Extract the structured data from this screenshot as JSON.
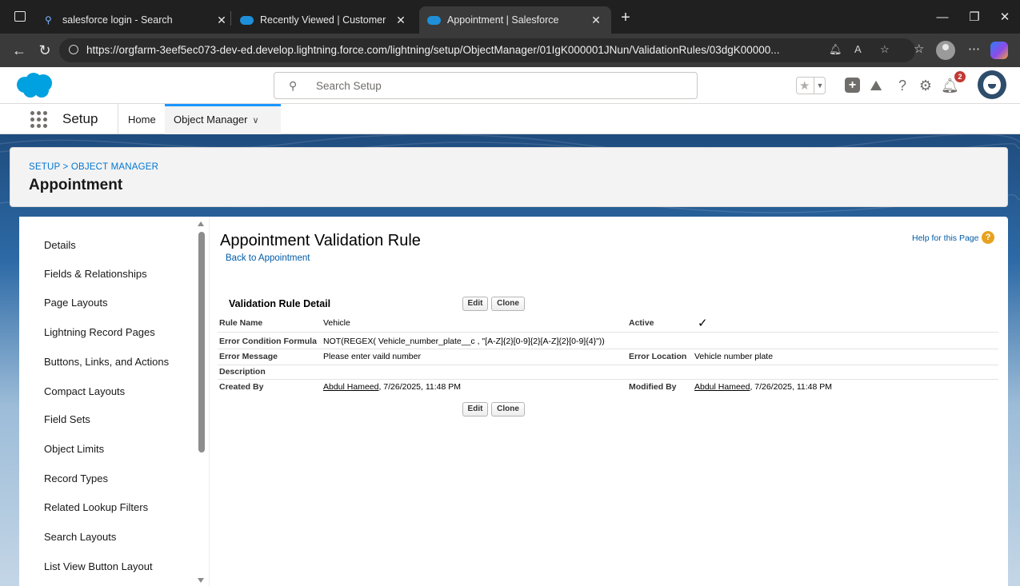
{
  "browser": {
    "tabs": [
      {
        "title": "salesforce login - Search",
        "active": false
      },
      {
        "title": "Recently Viewed | Customer Detai",
        "active": false
      },
      {
        "title": "Appointment | Salesforce",
        "active": true
      }
    ],
    "url": "https://orgfarm-3eef5ec073-dev-ed.develop.lightning.force.com/lightning/setup/ObjectManager/01IgK000001JNun/ValidationRules/03dgK00000..."
  },
  "header": {
    "search_placeholder": "Search Setup",
    "notification_count": "2",
    "colors": {
      "brand": "#00a1e0",
      "accent": "#0176d3"
    }
  },
  "context_nav": {
    "app_name": "Setup",
    "home_label": "Home",
    "object_manager_label": "Object Manager"
  },
  "object_header": {
    "breadcrumb": "SETUP > OBJECT MANAGER",
    "title": "Appointment"
  },
  "sidebar": {
    "items": [
      "Details",
      "Fields & Relationships",
      "Page Layouts",
      "Lightning Record Pages",
      "Buttons, Links, and Actions",
      "Compact Layouts",
      "Field Sets",
      "Object Limits",
      "Record Types",
      "Related Lookup Filters",
      "Search Layouts",
      "List View Button Layout"
    ]
  },
  "detail": {
    "page_title": "Appointment Validation Rule",
    "back_link": "Back to Appointment",
    "help_link": "Help for this Page",
    "section_title": "Validation Rule Detail",
    "edit_label": "Edit",
    "clone_label": "Clone",
    "fields": {
      "rule_name_label": "Rule Name",
      "rule_name_value": "Vehicle",
      "active_label": "Active",
      "active_value": "✓",
      "formula_label": "Error Condition Formula",
      "formula_value": "NOT(REGEX( Vehicle_number_plate__c , \"[A-Z]{2}[0-9]{2}[A-Z]{2}[0-9]{4}\"))",
      "message_label": "Error Message",
      "message_value": "Please enter vaild number",
      "location_label": "Error Location",
      "location_value": "Vehicle number plate",
      "description_label": "Description",
      "created_label": "Created By",
      "created_user": "Abdul Hameed",
      "created_date": ", 7/26/2025, 11:48 PM",
      "modified_label": "Modified By",
      "modified_user": "Abdul Hameed",
      "modified_date": ", 7/26/2025, 11:48 PM"
    }
  }
}
